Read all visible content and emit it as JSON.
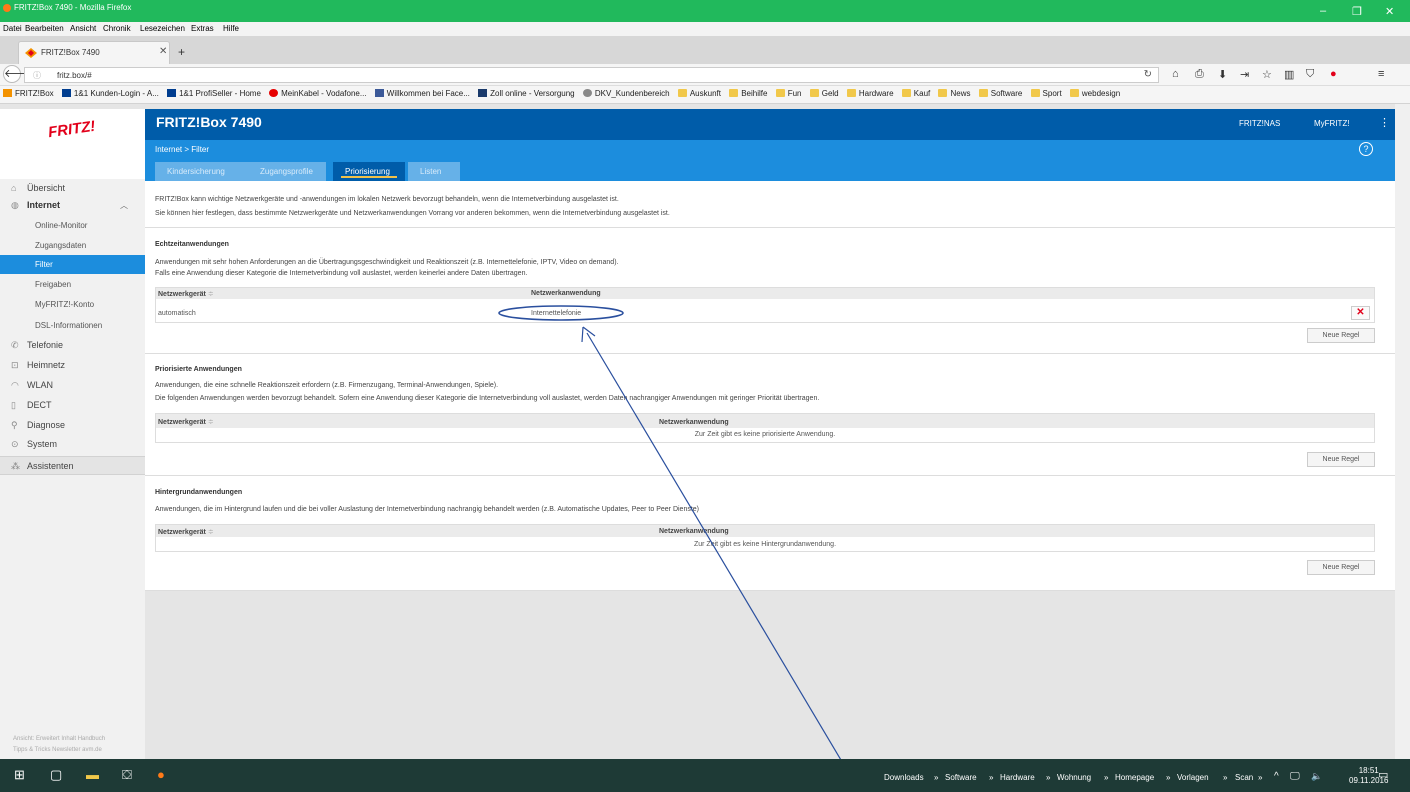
{
  "window": {
    "title": "FRITZ!Box 7490 - Mozilla Firefox"
  },
  "menu": [
    "Datei",
    "Bearbeiten",
    "Ansicht",
    "Chronik",
    "Lesezeichen",
    "Extras",
    "Hilfe"
  ],
  "tab": {
    "label": "FRITZ!Box 7490"
  },
  "url": "fritz.box/#",
  "bookmarks": [
    "FRITZ!Box",
    "1&1 Kunden-Login - A...",
    "1&1 ProfiSeller - Home",
    "MeinKabel - Vodafone...",
    "Willkommen bei Face...",
    "Zoll online - Versorgung",
    "DKV_Kundenbereich",
    "Auskunft",
    "Beihilfe",
    "Fun",
    "Geld",
    "Hardware",
    "Kauf",
    "News",
    "Software",
    "Sport",
    "webdesign"
  ],
  "header": {
    "title": "FRITZ!Box 7490",
    "fritznas": "FRITZ!NAS",
    "myfritz": "MyFRITZ!",
    "logo": "FRITZ!",
    "kebab": "⋮"
  },
  "breadcrumb": "Internet > Filter",
  "tabs": [
    "Kindersicherung",
    "Zugangsprofile",
    "Priorisierung",
    "Listen"
  ],
  "sidebar": {
    "items": [
      "Übersicht",
      "Internet",
      "Telefonie",
      "Heimnetz",
      "WLAN",
      "DECT",
      "Diagnose",
      "System",
      "Assistenten"
    ],
    "sub": [
      "Online-Monitor",
      "Zugangsdaten",
      "Filter",
      "Freigaben",
      "MyFRITZ!-Konto",
      "DSL-Informationen"
    ],
    "footer1": "Ansicht: Erweitert   Inhalt   Handbuch",
    "footer2": "Tipps & Tricks   Newsletter   avm.de"
  },
  "content": {
    "intro1": "FRITZ!Box kann wichtige Netzwerkgeräte und -anwendungen im lokalen Netzwerk bevorzugt behandeln, wenn die Internetverbindung ausgelastet ist.",
    "intro2": "Sie können hier festlegen, dass bestimmte Netzwerkgeräte und Netzwerkanwendungen Vorrang vor anderen bekommen, wenn die Internetverbindung ausgelastet ist.",
    "sec1": {
      "title": "Echtzeitanwendungen",
      "desc1": "Anwendungen mit sehr hohen Anforderungen an die Übertragungsgeschwindigkeit und Reaktionszeit (z.B. Internettelefonie, IPTV, Video on demand).",
      "desc2": "Falls eine Anwendung dieser Kategorie die Internetverbindung voll auslastet, werden keinerlei andere Daten übertragen.",
      "col1": "Netzwerkgerät",
      "col2": "Netzwerkanwendung",
      "row_device": "automatisch",
      "row_app": "Internettelefonie",
      "button": "Neue Regel"
    },
    "sec2": {
      "title": "Priorisierte Anwendungen",
      "desc1": "Anwendungen, die eine schnelle Reaktionszeit erfordern (z.B. Firmenzugang, Terminal-Anwendungen, Spiele).",
      "desc2": "Die folgenden Anwendungen werden bevorzugt behandelt. Sofern eine Anwendung dieser Kategorie die Internetverbindung voll auslastet, werden Daten nachrangiger Anwendungen mit geringer Priorität übertragen.",
      "col1": "Netzwerkgerät",
      "col2": "Netzwerkanwendung",
      "empty": "Zur Zeit gibt es keine priorisierte Anwendung.",
      "button": "Neue Regel"
    },
    "sec3": {
      "title": "Hintergrundanwendungen",
      "desc1": "Anwendungen, die im Hintergrund laufen und die bei voller Auslastung der Internetverbindung nachrangig behandelt werden (z.B. Automatische Updates, Peer to Peer Dienste)",
      "col1": "Netzwerkgerät",
      "col2": "Netzwerkanwendung",
      "empty": "Zur Zeit gibt es keine Hintergrundanwendung.",
      "button": "Neue Regel"
    }
  },
  "taskbar": {
    "toolbars": [
      "Downloads",
      "Software",
      "Hardware",
      "Wohnung",
      "Homepage",
      "Vorlagen",
      "Scan"
    ],
    "time": "18:51",
    "date": "09.11.2016"
  },
  "colors": {
    "fritz_blue": "#005ca9",
    "fritz_light_blue": "#1c8ddd",
    "fritz_red": "#e2001a",
    "firefox_titlebar": "#21b95c"
  }
}
